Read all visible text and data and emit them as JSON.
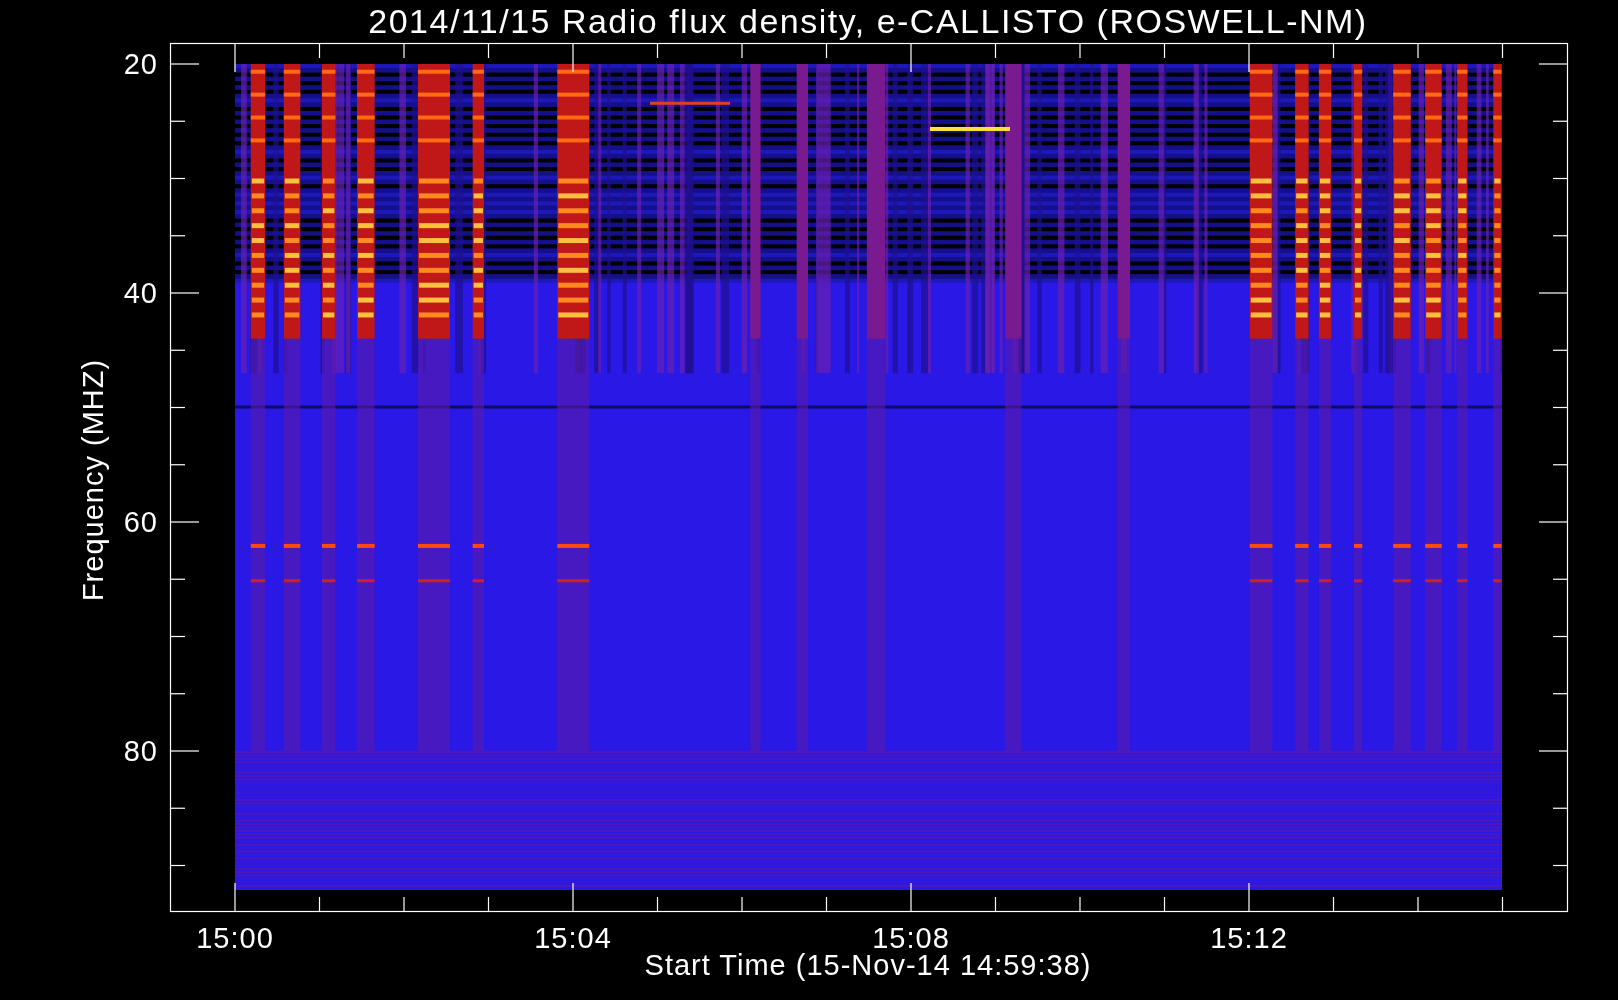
{
  "title": "2014/11/15  Radio flux density, e-CALLISTO (ROSWELL-NM)",
  "y_axis": {
    "label": "Frequency (MHZ)",
    "ticks": [
      "20",
      "40",
      "60",
      "80"
    ]
  },
  "x_axis": {
    "label": "Start Time (15-Nov-14 14:59:38)",
    "ticks": [
      "15:00",
      "15:04",
      "15:08",
      "15:12"
    ]
  }
}
